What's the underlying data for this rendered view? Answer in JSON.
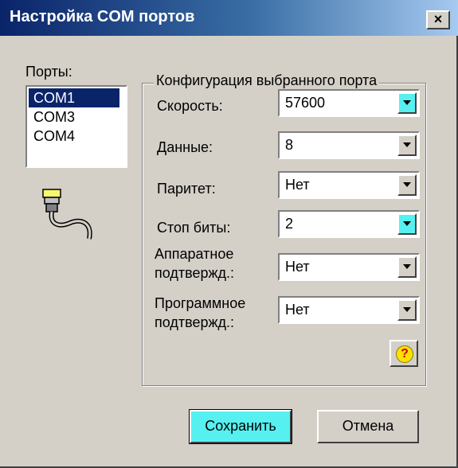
{
  "window": {
    "title": "Настройка COM портов",
    "close_glyph": "×"
  },
  "ports": {
    "label": "Порты:",
    "items": [
      "COM1",
      "COM3",
      "COM4"
    ],
    "selected": "COM1"
  },
  "group": {
    "title": "Конфигурация выбранного порта",
    "speed": {
      "label": "Скорость:",
      "value": "57600"
    },
    "data_bits": {
      "label": "Данные:",
      "value": "8"
    },
    "parity": {
      "label": "Паритет:",
      "value": "Нет"
    },
    "stop_bits": {
      "label": "Стоп биты:",
      "value": "2"
    },
    "hw_handshake": {
      "label_line1": "Аппаратное",
      "label_line2": "подтвержд.:",
      "value": "Нет"
    },
    "sw_handshake": {
      "label_line1": "Программное",
      "label_line2": "подтвержд.:",
      "value": "Нет"
    },
    "help_glyph": "?"
  },
  "buttons": {
    "save": "Сохранить",
    "cancel": "Отмена"
  },
  "icons": {
    "cable": "serial-cable-icon",
    "combo_arrow": "chevron-down-icon",
    "help": "help-icon",
    "close": "close-icon"
  },
  "colors": {
    "titlebar_start": "#0a246a",
    "titlebar_end": "#a6caf0",
    "dialog_bg": "#d4d0c8",
    "selection": "#0a246a",
    "focus_accent": "#57f0f0"
  }
}
